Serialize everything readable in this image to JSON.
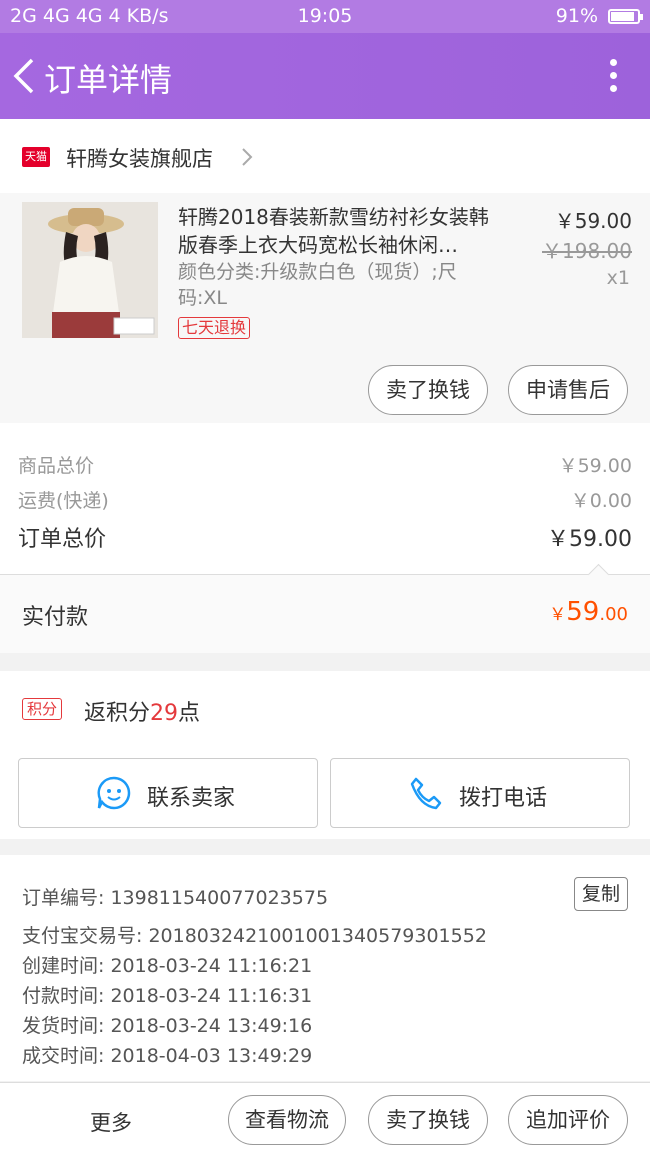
{
  "status": {
    "left": "2G 4G 4G 4 KB/s",
    "time": "19:05",
    "battery": "91%",
    "battery_level": 0.91
  },
  "header": {
    "title": "订单详情"
  },
  "shop": {
    "badge": "天猫",
    "name": "轩腾女装旗舰店"
  },
  "product": {
    "title": "轩腾2018春装新款雪纺衬衫女装韩版春季上衣大码宽松长袖休闲…",
    "spec": "颜色分类:升级款白色（现货）;尺码:XL",
    "return_tag": "七天退换",
    "price": "￥59.00",
    "original_price": "￥198.00",
    "quantity": "x1",
    "sell_label": "卖了换钱",
    "after_sale_label": "申请售后"
  },
  "summary": {
    "goods_label": "商品总价",
    "goods_value": "￥59.00",
    "ship_label": "运费(快递)",
    "ship_value": "￥0.00",
    "total_label": "订单总价",
    "total_value": "￥59.00"
  },
  "paid": {
    "label": "实付款",
    "currency": "￥",
    "integer": "59",
    "decimal": ".00"
  },
  "points": {
    "tag": "积分",
    "prefix": "返积分",
    "value": "29",
    "suffix": "点"
  },
  "contact": {
    "seller_label": "联系卖家",
    "call_label": "拨打电话"
  },
  "order_info": {
    "order_no": "订单编号: 139811540077023575",
    "copy_label": "复制",
    "alipay_no": "支付宝交易号: 2018032421001001340579301552",
    "created": "创建时间: 2018-03-24 11:16:21",
    "paid": "付款时间: 2018-03-24 11:16:31",
    "shipped": "发货时间: 2018-03-24 13:49:16",
    "completed": "成交时间: 2018-04-03 13:49:29"
  },
  "bottom": {
    "more_label": "更多",
    "logistics_label": "查看物流",
    "sell_label": "卖了换钱",
    "review_label": "追加评价"
  },
  "colors": {
    "header": "#a568e0",
    "accent": "#ff5000",
    "tag_red": "#e4393c",
    "icon_blue": "#1b9af7"
  }
}
